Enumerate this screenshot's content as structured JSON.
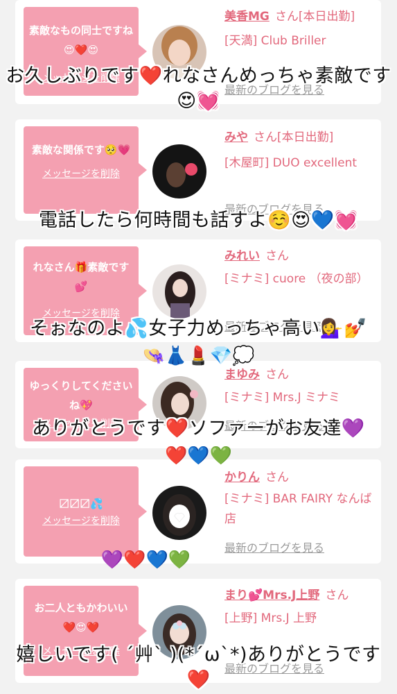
{
  "cards": [
    {
      "bubble_text": "素敵なもの同士ですね😍❤️😍",
      "delete_label": "メッセージを削除",
      "name": "美香MG",
      "san": "さん[本日出勤]",
      "shop": "[天満] Club Briller",
      "blog_label": "最新のブログを見る"
    },
    {
      "bubble_text": "素敵な関係です🥺💗",
      "delete_label": "メッセージを削除",
      "name": "みや",
      "san": "さん[本日出勤]",
      "shop": "[木屋町] DUO excellent",
      "blog_label": "最新のブログを見る"
    },
    {
      "bubble_text": "れなさん🎁素敵です💕",
      "delete_label": "メッセージを削除",
      "name": "みれい",
      "san": "さん",
      "shop": "[ミナミ] cuore （夜の部）",
      "blog_label": "最新のブログを見る"
    },
    {
      "bubble_text": "ゆっくりしてくださいね💖",
      "delete_label": "メッセージを削除",
      "name": "まゆみ",
      "san": "さん",
      "shop": "[ミナミ] Mrs.J ミナミ",
      "blog_label": "最新のブログを見る"
    },
    {
      "bubble_text": "〼〼〼💦",
      "delete_label": "メッセージを削除",
      "name": "かりん",
      "san": "さん",
      "shop": "[ミナミ] BAR FAIRY なんば店",
      "blog_label": "最新のブログを見る"
    },
    {
      "bubble_text": "お二人ともかわいい❤️😍❤️",
      "delete_label": "メッセージを削除",
      "name": "まり💕Mrs.J上野",
      "san": "さん",
      "shop": "[上野] Mrs.J 上野",
      "blog_label": "最新のブログを見る"
    }
  ],
  "overlays": [
    "お久しぶりです❤️れなさんめっちゃ素敵です😍💓",
    "電話したら何時間も話すよ☺️😍💙💓",
    "そぉなのよ💦女子力めっちゃ高い💁‍♀️💅",
    "👒👗💄💎💭",
    "ありがとうです❤️ソファーがお友達💜",
    "❤️💙💚",
    "💜❤️💙💚",
    "嬉しいです( ´艸` )(*´ω`*)ありがとうです❤️"
  ],
  "colors": {
    "accent": "#e2687c",
    "bubble": "#f4a0b1",
    "background": "#f2f2f2",
    "card": "#ffffff",
    "blog_link": "#9a9a9a"
  }
}
